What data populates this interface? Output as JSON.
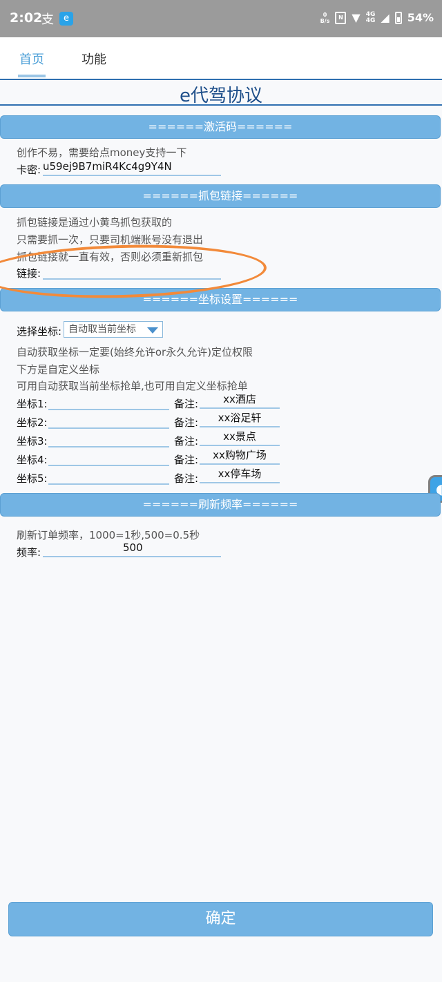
{
  "status_bar": {
    "time": "2:02",
    "speed_value": "0",
    "speed_unit": "B/s",
    "network": "4G",
    "battery": "54%"
  },
  "tabs": [
    {
      "label": "首页"
    },
    {
      "label": "功能"
    }
  ],
  "title": "e代驾协议",
  "activation": {
    "header": "======激活码======",
    "note": "创作不易，需要给点money支持一下",
    "card_label": "卡密:",
    "card_value": "u59ej9B7miR4Kc4g9Y4N"
  },
  "capture": {
    "header": "======抓包链接======",
    "notes": [
      "抓包链接是通过小黄鸟抓包获取的",
      "只需要抓一次，只要司机端账号没有退出",
      "抓包链接就一直有效，否则必须重新抓包"
    ],
    "link_label": "链接:",
    "link_value": ""
  },
  "coords": {
    "header": "======坐标设置======",
    "select_label": "选择坐标:",
    "select_value": "自动取当前坐标",
    "notes": [
      "自动获取坐标一定要(始终允许or永久允许)定位权限",
      "下方是自定义坐标",
      "可用自动获取当前坐标抢单,也可用自定义坐标抢单"
    ],
    "note_label": "备注:",
    "rows": [
      {
        "label": "坐标1:",
        "value": "",
        "remark": "xx酒店"
      },
      {
        "label": "坐标2:",
        "value": "",
        "remark": "xx浴足轩"
      },
      {
        "label": "坐标3:",
        "value": "",
        "remark": "xx景点"
      },
      {
        "label": "坐标4:",
        "value": "",
        "remark": "xx购物广场"
      },
      {
        "label": "坐标5:",
        "value": "",
        "remark": "xx停车场"
      }
    ]
  },
  "refresh": {
    "header": "======刷新频率======",
    "note": "刷新订单频率，1000=1秒,500=0.5秒",
    "freq_label": "频率:",
    "freq_value": "500"
  },
  "confirm_label": "确定",
  "colors": {
    "accent": "#72b3e3",
    "title": "#1e4f8a",
    "annotation": "#f28a3a"
  }
}
